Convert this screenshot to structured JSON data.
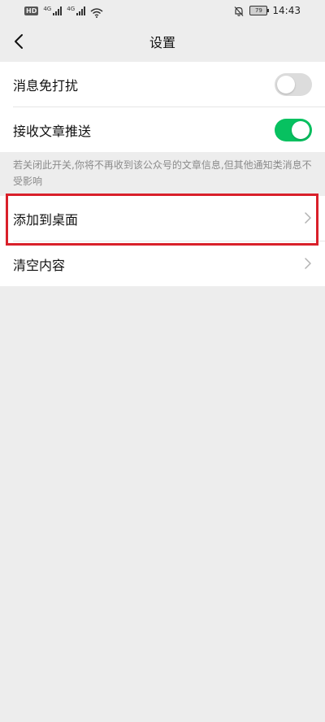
{
  "status_bar": {
    "hd_label": "HD",
    "network1": "4G",
    "network2": "4G",
    "battery": "79",
    "time": "14:43"
  },
  "nav": {
    "title": "设置"
  },
  "settings": {
    "mute_label": "消息免打扰",
    "mute_on": false,
    "receive_label": "接收文章推送",
    "receive_on": true,
    "note": "若关闭此开关,你将不再收到该公众号的文章信息,但其他通知类消息不受影响",
    "add_desktop_label": "添加到桌面",
    "clear_label": "清空内容"
  },
  "colors": {
    "toggle_on": "#07c160",
    "highlight": "#d9202a"
  }
}
